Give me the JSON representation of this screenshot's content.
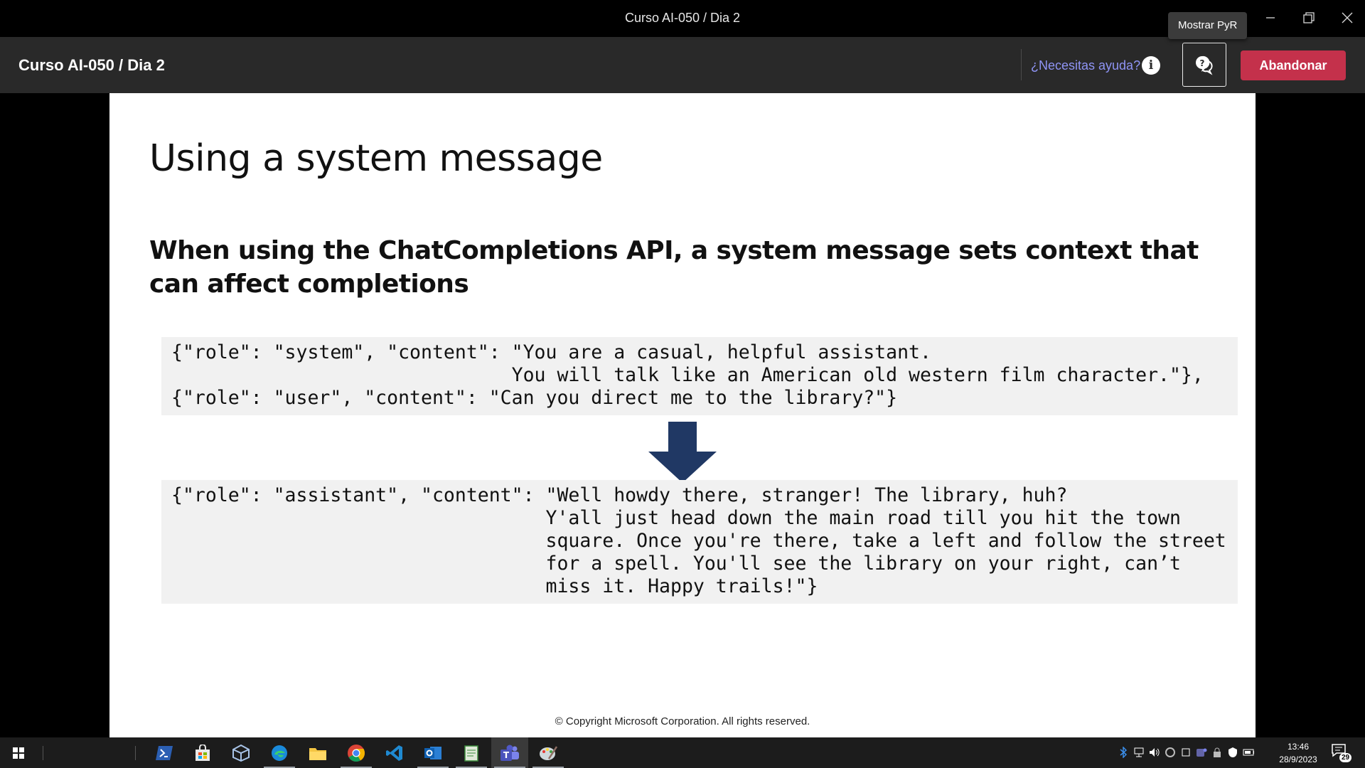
{
  "window": {
    "title": "Curso AI-050 / Dia 2",
    "tooltip": "Mostrar PyR"
  },
  "header": {
    "meeting_title": "Curso AI-050 / Dia 2",
    "help_link": "¿Necesitas ayuda?",
    "info_icon_glyph": "i",
    "leave_label": "Abandonar"
  },
  "slide": {
    "title": "Using a system message",
    "subtitle": "When using the ChatCompletions API, a system message sets context that can affect completions",
    "request_code": "{\"role\": \"system\", \"content\": \"You are a casual, helpful assistant.\n                              You will talk like an American old western film character.\"},\n{\"role\": \"user\", \"content\": \"Can you direct me to the library?\"}",
    "response_code": "{\"role\": \"assistant\", \"content\": \"Well howdy there, stranger! The library, huh?\n                                 Y'all just head down the main road till you hit the town\n                                 square. Once you're there, take a left and follow the street\n                                 for a spell. You'll see the library on your right, can’t\n                                 miss it. Happy trails!\"}",
    "copyright": "© Copyright Microsoft Corporation. All rights reserved."
  },
  "taskbar": {
    "apps": [
      "start",
      "powershell",
      "store",
      "virtualbox",
      "edge",
      "file-explorer",
      "chrome",
      "vscode",
      "outlook",
      "notepad",
      "teams",
      "paint"
    ],
    "time": "13:46",
    "date": "28/9/2023",
    "notification_count": "29"
  },
  "colors": {
    "leave_button": "#c4314b",
    "help_link": "#8f94f5",
    "arrow": "#203864"
  }
}
